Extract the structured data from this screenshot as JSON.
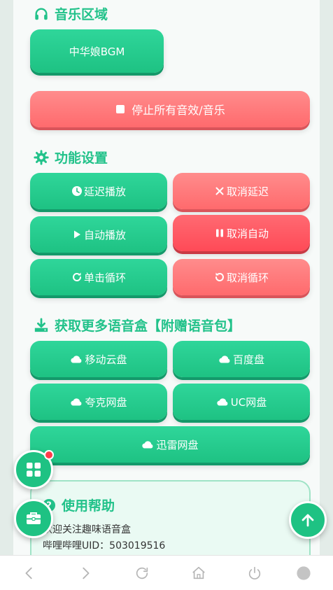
{
  "music_section": {
    "title": "音乐区域",
    "bgm_button": "中华娘BGM",
    "stop_button": "停止所有音效/音乐"
  },
  "settings_section": {
    "title": "功能设置",
    "delay_play": "延迟播放",
    "cancel_delay": "取消延迟",
    "auto_play": "自动播放",
    "cancel_auto": "取消自动",
    "single_loop": "单击循环",
    "cancel_loop": "取消循环"
  },
  "download_section": {
    "title": "获取更多语音盒【附赠语音包】",
    "mobile_cloud": "移动云盘",
    "baidu": "百度盘",
    "quark": "夸克网盘",
    "uc": "UC网盘",
    "xunlei": "迅雷网盘"
  },
  "help_section": {
    "title": "使用帮助",
    "line1": "欢迎关注趣味语音盒",
    "line2": "哔哩哔哩UID：503019516"
  },
  "colors": {
    "accent": "#22c28a",
    "button_green": "#1ec283",
    "button_red": "#ff6a6d",
    "badge": "#ff3b4a"
  }
}
